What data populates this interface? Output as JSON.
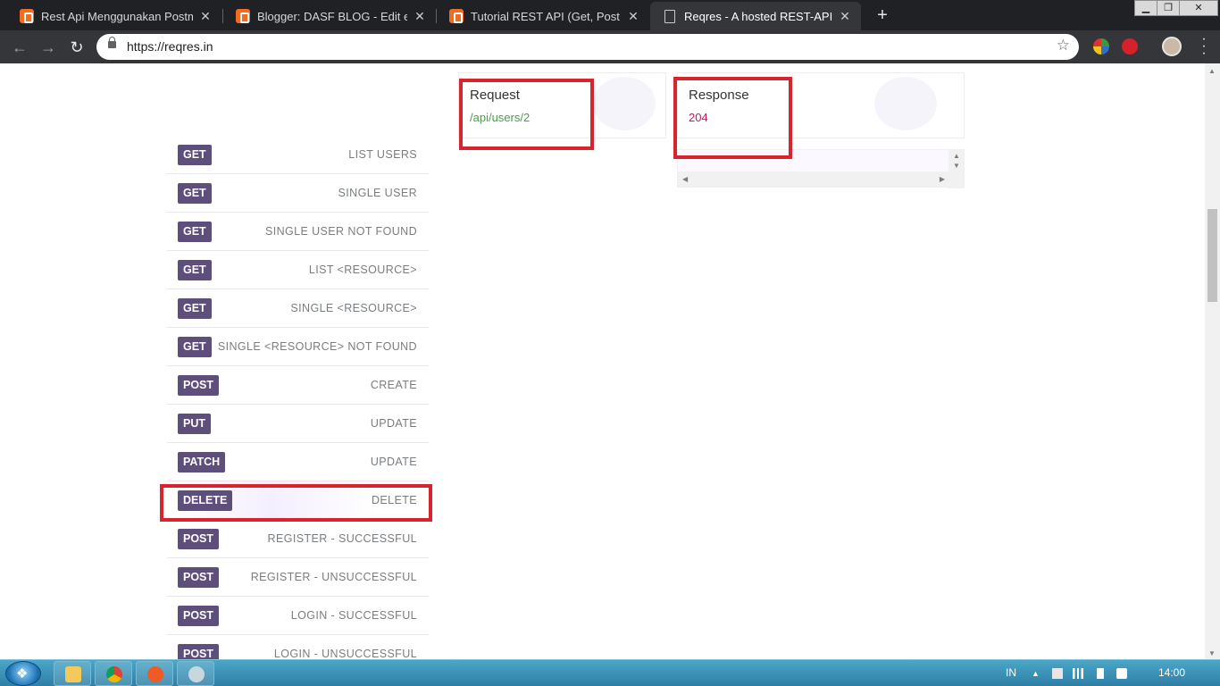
{
  "browser": {
    "tabs": [
      {
        "title": "Rest Api Menggunakan Postman",
        "close": "✕"
      },
      {
        "title": "Blogger: DASF BLOG - Edit entri",
        "close": "✕"
      },
      {
        "title": "Tutorial REST API (Get, Post, Put,",
        "close": "✕"
      },
      {
        "title": "Reqres - A hosted REST-API read",
        "close": "✕"
      }
    ],
    "new_tab": "+",
    "url": "https://reqres.in",
    "window_controls": {
      "minimize": "▁",
      "maximize": "❐",
      "close": "✕"
    }
  },
  "endpoints": [
    {
      "method": "GET",
      "label": "LIST USERS"
    },
    {
      "method": "GET",
      "label": "SINGLE USER"
    },
    {
      "method": "GET",
      "label": "SINGLE USER NOT FOUND"
    },
    {
      "method": "GET",
      "label": "LIST <RESOURCE>"
    },
    {
      "method": "GET",
      "label": "SINGLE <RESOURCE>"
    },
    {
      "method": "GET",
      "label": "SINGLE <RESOURCE> NOT FOUND"
    },
    {
      "method": "POST",
      "label": "CREATE"
    },
    {
      "method": "PUT",
      "label": "UPDATE"
    },
    {
      "method": "PATCH",
      "label": "UPDATE"
    },
    {
      "method": "DELETE",
      "label": "DELETE"
    },
    {
      "method": "POST",
      "label": "REGISTER - SUCCESSFUL"
    },
    {
      "method": "POST",
      "label": "REGISTER - UNSUCCESSFUL"
    },
    {
      "method": "POST",
      "label": "LOGIN - SUCCESSFUL"
    },
    {
      "method": "POST",
      "label": "LOGIN - UNSUCCESSFUL"
    }
  ],
  "selected_endpoint": "DELETE",
  "request": {
    "heading": "Request",
    "path": "/api/users/2"
  },
  "response": {
    "heading": "Response",
    "status": "204"
  },
  "taskbar": {
    "language": "IN",
    "clock": "14:00"
  },
  "colors": {
    "method_badge": "#5d4e7c",
    "request_path": "#46a046",
    "response_status": "#c2185b",
    "annotation": "#d7242e"
  }
}
